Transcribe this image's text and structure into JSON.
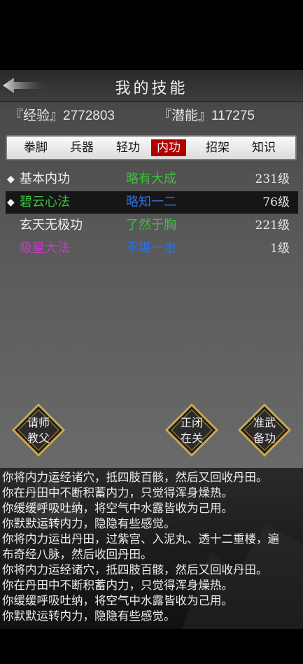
{
  "header": {
    "title": "我的技能"
  },
  "stats": {
    "experience": "『经验』2772803",
    "potential": "『潜能』117275"
  },
  "tabs": [
    {
      "label": "拳脚",
      "active": false
    },
    {
      "label": "兵器",
      "active": false
    },
    {
      "label": "轻功",
      "active": false
    },
    {
      "label": "内功",
      "active": true
    },
    {
      "label": "招架",
      "active": false
    },
    {
      "label": "知识",
      "active": false
    }
  ],
  "skills": [
    {
      "bullet": "◆",
      "name": "基本内功",
      "name_color": "#f0f0f0",
      "level_text": "略有大成",
      "level_color": "#3fbf3f",
      "grade": "231级",
      "selected": false
    },
    {
      "bullet": "◆",
      "name": "碧云心法",
      "name_color": "#3fbf3f",
      "level_text": "略知一二",
      "level_color": "#2f6fe0",
      "grade": "76级",
      "selected": true
    },
    {
      "bullet": "",
      "name": "玄天无极功",
      "name_color": "#f0f0f0",
      "level_text": "了然于胸",
      "level_color": "#3fbf3f",
      "grade": "221级",
      "selected": false
    },
    {
      "bullet": "",
      "name": "吸星大法",
      "name_color": "#c43cc4",
      "level_text": "不堪一击",
      "level_color": "#2f6fe0",
      "grade": "1级",
      "selected": false
    }
  ],
  "actions": {
    "ask_master": [
      "请师",
      "教父"
    ],
    "toggle_practice": [
      "正闭",
      "在关"
    ],
    "prepare_skill": [
      "准武",
      "备功"
    ]
  },
  "log": [
    "你将内力运经诸穴，抵四肢百骸，然后又回收丹田。",
    "你在丹田中不断积蓄内力，只觉得浑身燥热。",
    "你缓缓呼吸吐纳，将空气中水露皆收为己用。",
    "你默默运转内力，隐隐有些感觉。",
    "你将内力运出丹田，过紫宫、入泥丸、透十二重楼，遍",
    "布奇经八脉，然后收回丹田。",
    "你将内力运经诸穴，抵四肢百骸，然后又回收丹田。",
    "你在丹田中不断积蓄内力，只觉得浑身燥热。",
    "你缓缓呼吸吐纳，将空气中水露皆收为己用。",
    "你默默运转内力，隐隐有些感觉。"
  ],
  "colors": {
    "active_tab": "#b10000",
    "panel": "#4a4a4a"
  }
}
